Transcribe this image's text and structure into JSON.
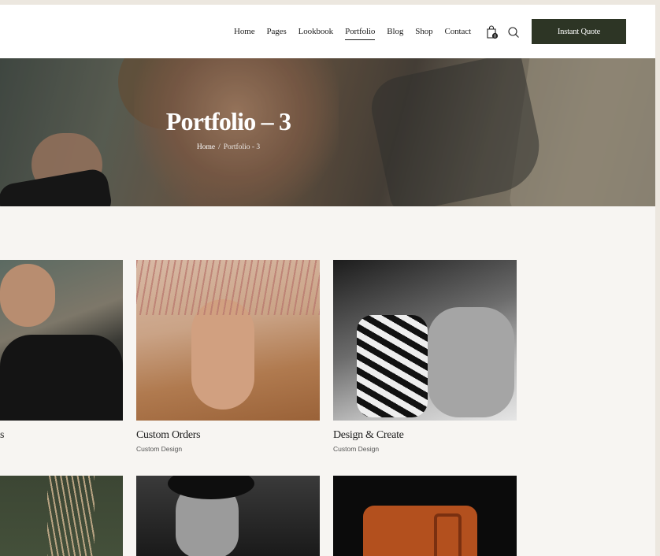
{
  "nav": {
    "items": [
      {
        "label": "Home",
        "active": false
      },
      {
        "label": "Pages",
        "active": false
      },
      {
        "label": "Lookbook",
        "active": false
      },
      {
        "label": "Portfolio",
        "active": true
      },
      {
        "label": "Blog",
        "active": false
      },
      {
        "label": "Shop",
        "active": false
      },
      {
        "label": "Contact",
        "active": false
      }
    ],
    "cart_count": "0",
    "cart_icon": "shopping-bag-icon",
    "search_icon": "search-icon",
    "cta_label": "Instant Quote"
  },
  "hero": {
    "title": "Portfolio – 3",
    "breadcrumb": {
      "home": "Home",
      "separator": "/",
      "current": "Portfolio - 3"
    }
  },
  "portfolio": {
    "items": [
      {
        "title": "s",
        "category": ""
      },
      {
        "title": "Custom Orders",
        "category": "Custom Design"
      },
      {
        "title": "Design & Create",
        "category": "Custom Design"
      },
      {
        "title": "",
        "category": ""
      },
      {
        "title": "",
        "category": ""
      },
      {
        "title": "",
        "category": ""
      }
    ]
  },
  "colors": {
    "background": "#f7f5f2",
    "header": "#ffffff",
    "accent": "#2d3525",
    "text": "#1e1e1e"
  }
}
